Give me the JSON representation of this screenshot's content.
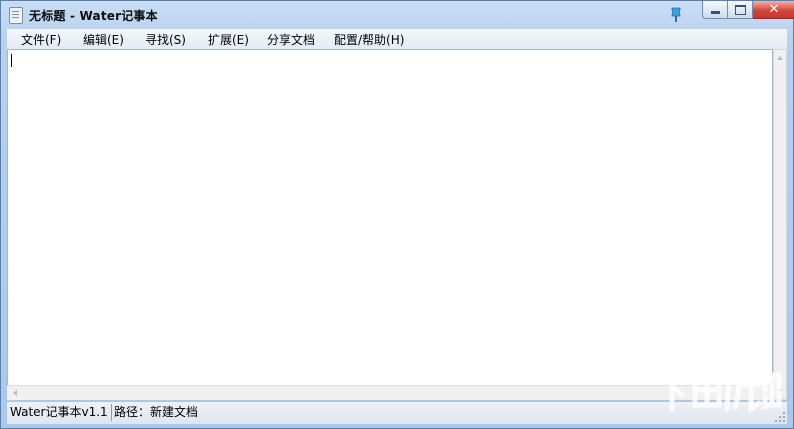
{
  "window": {
    "title": "无标题 - Water记事本"
  },
  "menu": {
    "file": "文件(F)",
    "edit": "编辑(E)",
    "find": "寻找(S)",
    "extend": "扩展(E)",
    "share": "分享文档",
    "config": "配置/帮助(H)"
  },
  "editor": {
    "content": ""
  },
  "status": {
    "version": "Water记事本v1.1",
    "path": "路径：新建文档"
  },
  "icons": {
    "app": "notepad-icon",
    "pin": "pin-icon",
    "minimize": "minimize-icon",
    "maximize": "maximize-icon",
    "close": "close-icon",
    "watermark": "download-site-logo"
  },
  "colors": {
    "titlebar": "#b6d1ee",
    "close_button": "#d3463a",
    "editor_bg": "#ffffff"
  }
}
